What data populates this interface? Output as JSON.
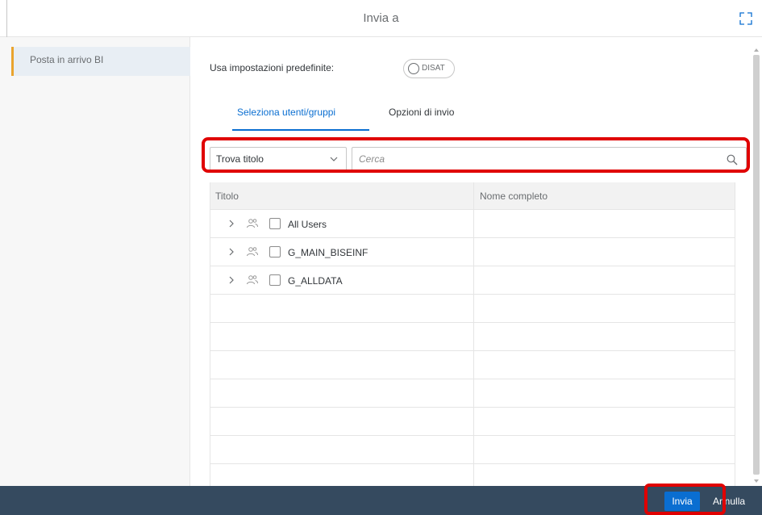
{
  "dialog": {
    "title": "Invia a",
    "expand_icon": "expand-icon"
  },
  "sidebar": {
    "items": [
      {
        "label": "Posta in arrivo BI",
        "selected": true
      }
    ],
    "accent_color": "#e9a42e"
  },
  "defaults": {
    "label": "Usa impostazioni predefinite:",
    "toggle_text": "DISAT",
    "toggle_on": false
  },
  "tabs": [
    {
      "label": "Seleziona utenti/gruppi",
      "active": true
    },
    {
      "label": "Opzioni di invio",
      "active": false
    }
  ],
  "search": {
    "find_select_value": "Trova titolo",
    "placeholder": "Cerca",
    "value": ""
  },
  "table": {
    "columns": [
      "Titolo",
      "Nome completo"
    ],
    "rows": [
      {
        "title": "All Users",
        "full_name": ""
      },
      {
        "title": "G_MAIN_BISEINF",
        "full_name": ""
      },
      {
        "title": "G_ALLDATA",
        "full_name": ""
      }
    ]
  },
  "footer": {
    "send_label": "Invia",
    "cancel_label": "Annulla",
    "bar_color": "#354a5f",
    "primary_color": "#0a6ed1"
  },
  "highlight_color": "#e00000"
}
